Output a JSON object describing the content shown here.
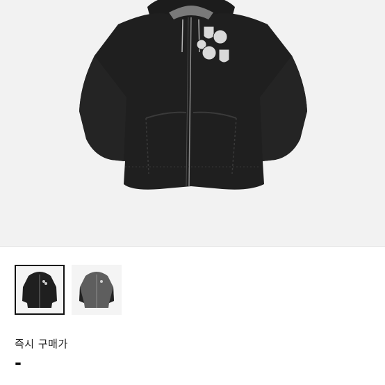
{
  "product": {
    "main_image": "black-zip-hoodie-with-patches",
    "colors": {
      "hoodie_black": "#1f1f1f",
      "hoodie_grey": "#5e5e5e",
      "patch": "#d9d9d9",
      "background": "#f2f2f2"
    }
  },
  "gallery": {
    "thumbnails": [
      {
        "image": "black-hoodie-thumbnail",
        "selected": true
      },
      {
        "image": "grey-hoodie-thumbnail",
        "selected": false
      }
    ]
  },
  "purchase": {
    "label": "즉시 구매가",
    "price": "-"
  }
}
